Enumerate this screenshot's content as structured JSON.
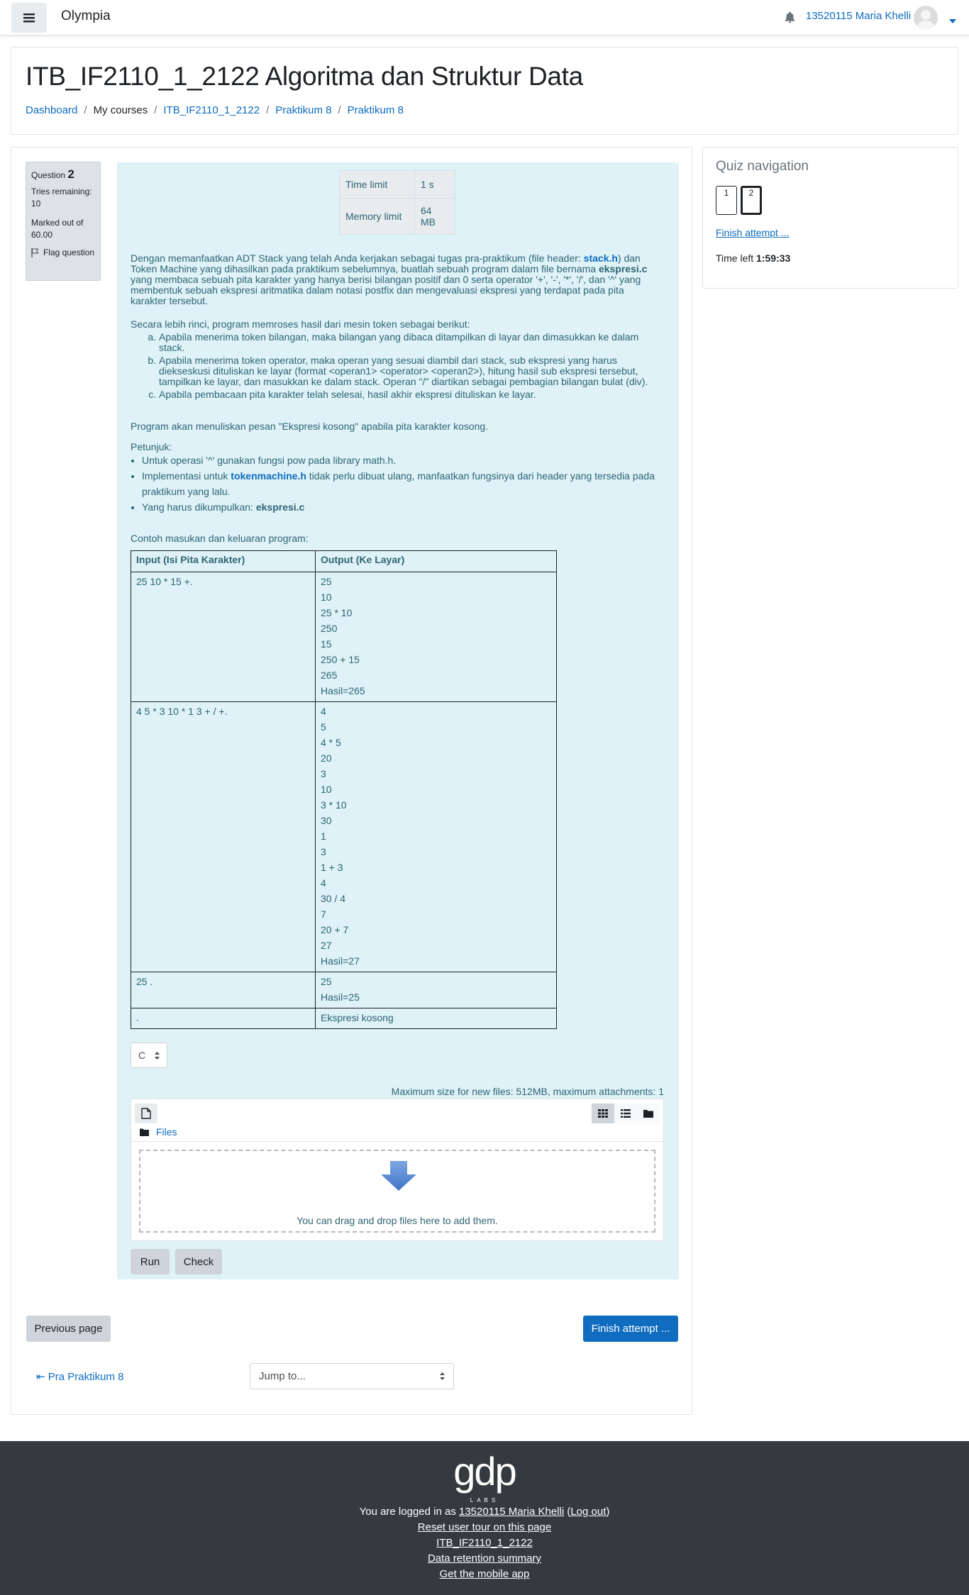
{
  "navbar": {
    "brand": "Olympia",
    "user_name": "13520115 Maria Khelli"
  },
  "header": {
    "title": "ITB_IF2110_1_2122 Algoritma dan Struktur Data",
    "breadcrumb": [
      "Dashboard",
      "My courses",
      "ITB_IF2110_1_2122",
      "Praktikum 8",
      "Praktikum 8"
    ]
  },
  "question_info": {
    "label": "Question",
    "number": "2",
    "tries": "Tries remaining: 10",
    "marked": "Marked out of 60.00",
    "flag": "Flag question"
  },
  "limits": {
    "time_label": "Time limit",
    "time_value": "1 s",
    "memory_label": "Memory limit",
    "memory_value": "64 MB"
  },
  "question": {
    "p1_a": "Dengan memanfaatkan ADT Stack yang telah Anda kerjakan sebagai tugas pra-praktikum (file header: ",
    "p1_link1": "stack.h",
    "p1_b": ") dan Token Machine yang dihasilkan pada praktikum sebelumnya, buatlah sebuah program dalam file bernama ",
    "p1_bold": "ekspresi.c",
    "p1_c": " yang membaca sebuah pita karakter yang hanya berisi bilangan positif dan 0 serta operator '+', '-', '*', '/', dan '^' yang membentuk sebuah ekspresi aritmatika dalam notasi postfix dan mengevaluasi ekspresi yang terdapat pada pita karakter tersebut.",
    "p2": "Secara lebih rinci, program memroses hasil dari mesin token sebagai berikut:",
    "steps": [
      "Apabila menerima token bilangan, maka bilangan yang dibaca ditampilkan di layar dan dimasukkan ke dalam stack.",
      "Apabila menerima token operator, maka operan yang sesuai diambil dari stack, sub ekspresi yang harus diekseskusi dituliskan ke layar (format <operan1> <operator> <operan2>), hitung hasil sub ekspresi tersebut, tampilkan ke layar, dan masukkan ke dalam stack. Operan \"/\" diartikan sebagai pembagian bilangan bulat (div).",
      "Apabila pembacaan pita karakter telah selesai, hasil akhir ekspresi dituliskan ke layar."
    ],
    "p3": "Program akan menuliskan pesan \"Ekspresi kosong\" apabila pita karakter kosong.",
    "hint_title": "Petunjuk:",
    "hint1": "Untuk operasi '^' gunakan fungsi pow pada library math.h.",
    "hint2_a": "Implementasi untuk ",
    "hint2_link": "tokenmachine.h",
    "hint2_b": " tidak perlu dibuat ulang, manfaatkan fungsinya dari header yang tersedia pada praktikum yang lalu.",
    "hint3_a": "Yang harus dikumpulkan: ",
    "hint3_bold": "ekspresi.c",
    "example_title": "Contoh masukan dan keluaran program:"
  },
  "io_table": {
    "header_input": "Input (Isi Pita Karakter)",
    "header_output": "Output (Ke Layar)",
    "rows": [
      {
        "input": "25 10 * 15 +.",
        "output": [
          "25",
          "10",
          "25 * 10",
          "250",
          "15",
          "250 + 15",
          "265",
          "Hasil=265"
        ]
      },
      {
        "input": "4 5 * 3 10 * 1 3 + / +.",
        "output": [
          "4",
          "5",
          "4 * 5",
          "20",
          "3",
          "10",
          "3 * 10",
          "30",
          "1",
          "3",
          "1 + 3",
          "4",
          "30 / 4",
          "7",
          "20 + 7",
          "27",
          "Hasil=27"
        ]
      },
      {
        "input": "25 .",
        "output": [
          "25",
          "Hasil=25"
        ]
      },
      {
        "input": ".",
        "output": [
          "Ekspresi kosong"
        ]
      }
    ]
  },
  "submission": {
    "language": "C",
    "max_size": "Maximum size for new files: 512MB, maximum attachments: 1",
    "files_label": "Files",
    "drop_text": "You can drag and drop files here to add them.",
    "run_label": "Run",
    "check_label": "Check"
  },
  "navigation": {
    "previous_page": "Previous page",
    "finish_attempt": "Finish attempt ...",
    "prev_activity": "Pra Praktikum 8",
    "jump_to": "Jump to..."
  },
  "quiz_nav": {
    "title": "Quiz navigation",
    "questions": [
      "1",
      "2"
    ],
    "finish_link": "Finish attempt ...",
    "time_left_label": "Time left",
    "time_left_value": "1:59:33"
  },
  "footer": {
    "logo_text": "gdp",
    "logo_sub": "LABS",
    "logged_in_prefix": "You are logged in as ",
    "logged_in_user": "13520115 Maria Khelli",
    "logout": "Log out",
    "reset_tour": "Reset user tour on this page",
    "course_link": "ITB_IF2110_1_2122",
    "data_retention": "Data retention summary",
    "mobile_app": "Get the mobile app"
  },
  "colors": {
    "primary": "#0f6cbf",
    "question_bg": "#def2f8",
    "question_text": "#2f6473",
    "footer_bg": "#343a40"
  }
}
